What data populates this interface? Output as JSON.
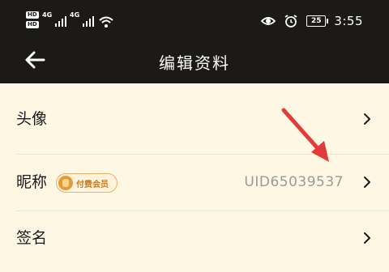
{
  "status_bar": {
    "hd1": "HD",
    "hd2": "HD",
    "net1": "4G",
    "net2": "4G",
    "battery": "25",
    "time": "3:55"
  },
  "nav": {
    "back_icon": "arrow-left-icon",
    "title": "编辑资料"
  },
  "rows": [
    {
      "label": "头像",
      "value": ""
    },
    {
      "label": "昵称",
      "value": "UID65039537",
      "badge": "付费会员"
    },
    {
      "label": "签名",
      "value": ""
    }
  ],
  "colors": {
    "header_bg": "#1c1a17",
    "page_bg": "#fdf7e4",
    "annotation_arrow": "#e23b3b",
    "badge_text": "#c87920"
  }
}
